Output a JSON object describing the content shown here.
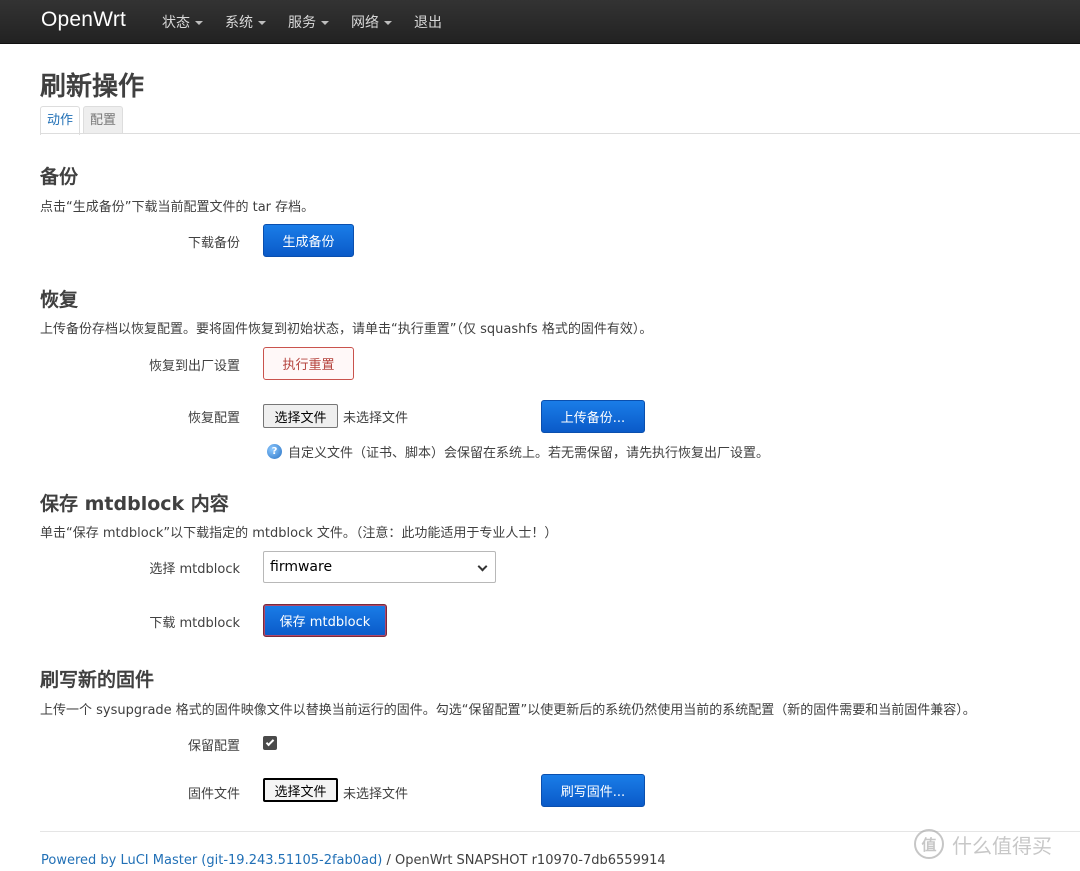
{
  "nav": {
    "brand": "OpenWrt",
    "menu": [
      {
        "label": "状态",
        "has_caret": true
      },
      {
        "label": "系统",
        "has_caret": true
      },
      {
        "label": "服务",
        "has_caret": true
      },
      {
        "label": "网络",
        "has_caret": true
      },
      {
        "label": "退出",
        "has_caret": false
      }
    ]
  },
  "page": {
    "title": "刷新操作",
    "tabs": [
      {
        "label": "动作",
        "active": true
      },
      {
        "label": "配置",
        "active": false
      }
    ]
  },
  "backup": {
    "title": "备份",
    "description": "点击“生成备份”下载当前配置文件的 tar 存档。",
    "download_label": "下载备份",
    "generate_button": "生成备份"
  },
  "restore": {
    "title": "恢复",
    "description": "上传备份存档以恢复配置。要将固件恢复到初始状态，请单击“执行重置”（仅 squashfs 格式的固件有效）。",
    "factory_label": "恢复到出厂设置",
    "reset_button": "执行重置",
    "restore_label": "恢复配置",
    "choose_file": "选择文件",
    "no_file": "未选择文件",
    "upload_button": "上传备份...",
    "hint": "自定义文件（证书、脚本）会保留在系统上。若无需保留，请先执行恢复出厂设置。",
    "hint_icon": "info-icon"
  },
  "mtdblock": {
    "title": "保存 mtdblock 内容",
    "description": "单击“保存 mtdblock”以下载指定的 mtdblock 文件。（注意：此功能适用于专业人士！）",
    "select_label": "选择 mtdblock",
    "selected_value": "firmware",
    "download_label": "下载 mtdblock",
    "save_button": "保存 mtdblock"
  },
  "flash": {
    "title": "刷写新的固件",
    "description": "上传一个 sysupgrade 格式的固件映像文件以替换当前运行的固件。勾选“保留配置”以使更新后的系统仍然使用当前的系统配置（新的固件需要和当前固件兼容）。",
    "keep_label": "保留配置",
    "keep_checked": true,
    "firmware_label": "固件文件",
    "choose_file": "选择文件",
    "no_file": "未选择文件",
    "flash_button": "刷写固件..."
  },
  "footer": {
    "link_text": "Powered by LuCI Master (git-19.243.51105-2fab0ad)",
    "separator": " / ",
    "version": "OpenWrt SNAPSHOT r10970-7db6559914"
  },
  "watermark": {
    "glyph": "值",
    "text": "什么值得买"
  },
  "colors": {
    "topbar": "#222222",
    "primary_button": "#0a5ac8",
    "danger": "#c9534d",
    "link": "#2170b6"
  }
}
